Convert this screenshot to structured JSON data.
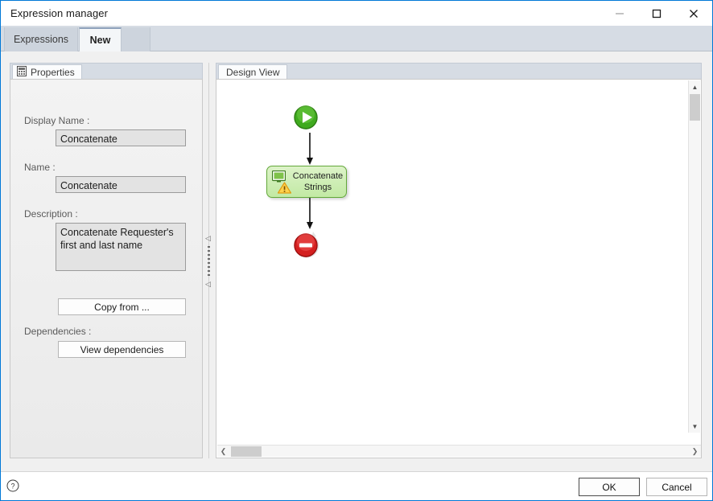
{
  "window": {
    "title": "Expression manager",
    "accent_color": "#0078d7",
    "controls": {
      "minimize": "minimize-icon",
      "maximize": "maximize-icon",
      "close": "close-icon"
    }
  },
  "tabs": [
    {
      "label": "Expressions",
      "active": false
    },
    {
      "label": "New",
      "active": true
    }
  ],
  "properties_panel": {
    "tab_label": "Properties",
    "tab_icon": "properties-grid-icon",
    "fields": {
      "display_name_label": "Display Name :",
      "display_name_value": "Concatenate",
      "name_label": "Name :",
      "name_value": "Concatenate",
      "description_label": "Description :",
      "description_value": "Concatenate Requester's first and last name"
    },
    "copy_from_button": "Copy from ...",
    "dependencies_label": "Dependencies :",
    "view_dependencies_button": "View dependencies"
  },
  "splitter": {
    "collapse_arrow": "◁",
    "grip": "splitter-grip"
  },
  "design_panel": {
    "tab_label": "Design View",
    "nodes": {
      "start": {
        "name": "start-node",
        "color": "#3faa1e"
      },
      "activity": {
        "name": "activity-node",
        "label_line1": "Concatenate",
        "label_line2": "Strings",
        "fill_color": "#cfeeb6",
        "border_color": "#63a83a",
        "icons": [
          "monitor-icon",
          "warning-icon"
        ]
      },
      "end": {
        "name": "end-node",
        "color": "#d42020"
      }
    },
    "scrollbars": {
      "v_up": "▲",
      "v_down": "▼",
      "h_left": "❮",
      "h_right": "❯"
    }
  },
  "footer": {
    "help_icon": "help-icon",
    "ok_button": "OK",
    "cancel_button": "Cancel"
  }
}
